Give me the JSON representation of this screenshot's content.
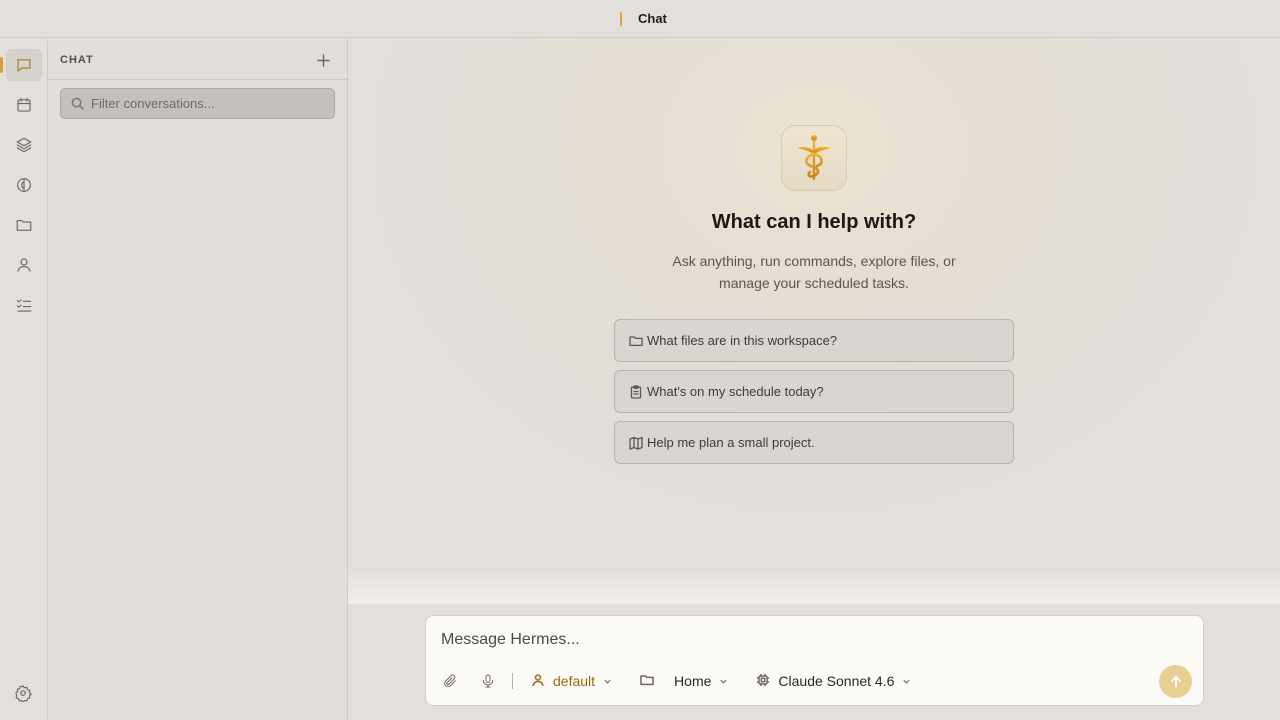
{
  "window": {
    "title": "Chat"
  },
  "activity_bar": {
    "items": [
      {
        "name": "chat-icon",
        "active": true
      },
      {
        "name": "calendar-icon",
        "active": false
      },
      {
        "name": "layers-icon",
        "active": false
      },
      {
        "name": "brain-icon",
        "active": false
      },
      {
        "name": "folder-icon",
        "active": false
      },
      {
        "name": "user-icon",
        "active": false
      },
      {
        "name": "checklist-icon",
        "active": false
      }
    ],
    "settings_icon": "gear-icon"
  },
  "sidebar": {
    "title": "CHAT",
    "search_placeholder": "Filter conversations..."
  },
  "main": {
    "heading": "What can I help with?",
    "subheading": "Ask anything, run commands, explore files, or manage your scheduled tasks.",
    "suggestions": [
      {
        "icon": "folder-icon",
        "label": "What files are in this workspace?"
      },
      {
        "icon": "clipboard-icon",
        "label": "What's on my schedule today?"
      },
      {
        "icon": "map-icon",
        "label": "Help me plan a small project."
      }
    ]
  },
  "composer": {
    "placeholder": "Message Hermes...",
    "profile": "default",
    "workspace": "Home",
    "model": "Claude Sonnet 4.6"
  },
  "colors": {
    "accent": "#d9a03a",
    "send_button": "#e8cf93"
  }
}
